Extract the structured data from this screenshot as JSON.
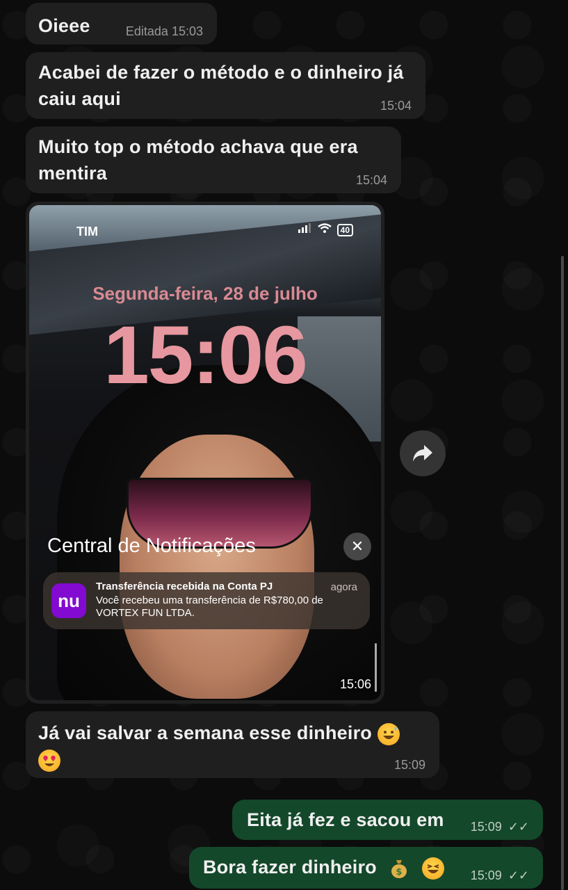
{
  "messages": {
    "m1": {
      "text": "Oieee",
      "edited": "Editada",
      "time": "15:03"
    },
    "m2": {
      "text": "Acabei de fazer o método e o dinheiro já caiu aqui",
      "time": "15:04"
    },
    "m3": {
      "text": "Muito top o método achava que era mentira",
      "time": "15:04"
    },
    "m5": {
      "text": "Já vai salvar a semana esse dinheiro",
      "time": "15:09"
    },
    "m6": {
      "text": "Eita já fez e sacou em",
      "time": "15:09"
    },
    "m7": {
      "text": "Bora fazer dinheiro",
      "time": "15:09"
    }
  },
  "screenshot": {
    "carrier": "TIM",
    "battery": "40",
    "date": "Segunda-feira, 28 de julho",
    "clock": "15:06",
    "notification_center_title": "Central de Notificações",
    "notification": {
      "app_logo": "nu",
      "title": "Transferência recebida na Conta PJ",
      "time": "agora",
      "body": "Você recebeu uma transferência de R$780,00 de VORTEX FUN LTDA."
    },
    "message_time": "15:06"
  },
  "icons": {
    "forward": "forward-icon",
    "read_receipt": "double-check-icon",
    "emojis": [
      "sweat-smile-emoji",
      "heart-eyes-emoji",
      "money-bag-emoji",
      "laughing-emoji"
    ]
  },
  "colors": {
    "incoming_bubble": "#1f1f1f",
    "outgoing_bubble": "#14482a",
    "background": "#0b0b0b",
    "nubank_purple": "#820ad1"
  }
}
